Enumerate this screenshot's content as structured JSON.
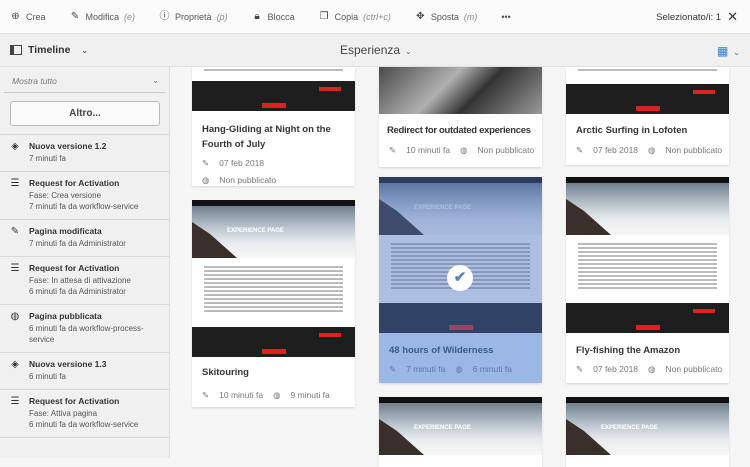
{
  "toolbar": {
    "items": [
      {
        "icon": "plus-circle-icon",
        "label": "Crea",
        "shortcut": ""
      },
      {
        "icon": "pencil-icon",
        "label": "Modifica",
        "shortcut": "(e)"
      },
      {
        "icon": "info-icon",
        "label": "Proprietà",
        "shortcut": "(p)"
      },
      {
        "icon": "lock-icon",
        "label": "Blocca",
        "shortcut": ""
      },
      {
        "icon": "copy-icon",
        "label": "Copia",
        "shortcut": "(ctrl+c)"
      },
      {
        "icon": "move-icon",
        "label": "Sposta",
        "shortcut": "(m)"
      }
    ],
    "more": "•••",
    "selected": "Selezionato/i: 1",
    "close": "✕"
  },
  "header": {
    "rail": "Timeline",
    "title": "Esperienza"
  },
  "sidebar": {
    "filter": "Mostra tutto",
    "more_button": "Altro...",
    "items": [
      {
        "icon": "layers-icon",
        "title": "Nuova versione 1.2",
        "lines": [
          "7 minuti fa"
        ]
      },
      {
        "icon": "workflow-icon",
        "title": "Request for Activation",
        "lines": [
          "Fase: Crea versione",
          "7 minuti fa da workflow-service"
        ]
      },
      {
        "icon": "pencil-icon",
        "title": "Pagina modificata",
        "lines": [
          "7 minuti fa da Administrator"
        ]
      },
      {
        "icon": "workflow-icon",
        "title": "Request for Activation",
        "lines": [
          "Fase: In attesa di attivazione",
          "6 minuti fa da Administrator"
        ]
      },
      {
        "icon": "globe-icon",
        "title": "Pagina pubblicata",
        "lines": [
          "6 minuti fa da workflow-process-",
          "service"
        ]
      },
      {
        "icon": "layers-icon",
        "title": "Nuova versione 1.3",
        "lines": [
          "6 minuti fa"
        ]
      },
      {
        "icon": "workflow-icon",
        "title": "Request for Activation",
        "lines": [
          "Fase: Attiva pagina",
          "6 minuti fa da workflow-service"
        ]
      }
    ]
  },
  "cards": [
    {
      "title": "Hang-Gliding at Night on the Fourth of July",
      "modified": "07 feb 2018",
      "published": "Non pubblicato"
    },
    {
      "title": "Redirect for outdated experiences",
      "modified": "10 minuti fa",
      "published": "Non pubblicato"
    },
    {
      "title": "Arctic Surfing in Lofoten",
      "modified": "07 feb 2018",
      "published": "Non pubblicato"
    },
    {
      "title": "Skitouring",
      "modified": "10 minuti fa",
      "published": "9 minuti fa",
      "thumb_title": "EXPERIENCE PAGE"
    },
    {
      "title": "48 hours of Wilderness",
      "modified": "7 minuti fa",
      "published": "6 minuti fa",
      "thumb_title": "EXPERIENCE PAGE",
      "selected": true
    },
    {
      "title": "Fly-fishing the Amazon",
      "modified": "07 feb 2018",
      "published": "Non pubblicato"
    },
    {
      "thumb_title": "EXPERIENCE PAGE"
    },
    {
      "thumb_title": "EXPERIENCE PAGE"
    }
  ],
  "colors": {
    "selection": "#9bb7e3",
    "accent": "#2d7bd6",
    "brand_red": "#e02020"
  }
}
